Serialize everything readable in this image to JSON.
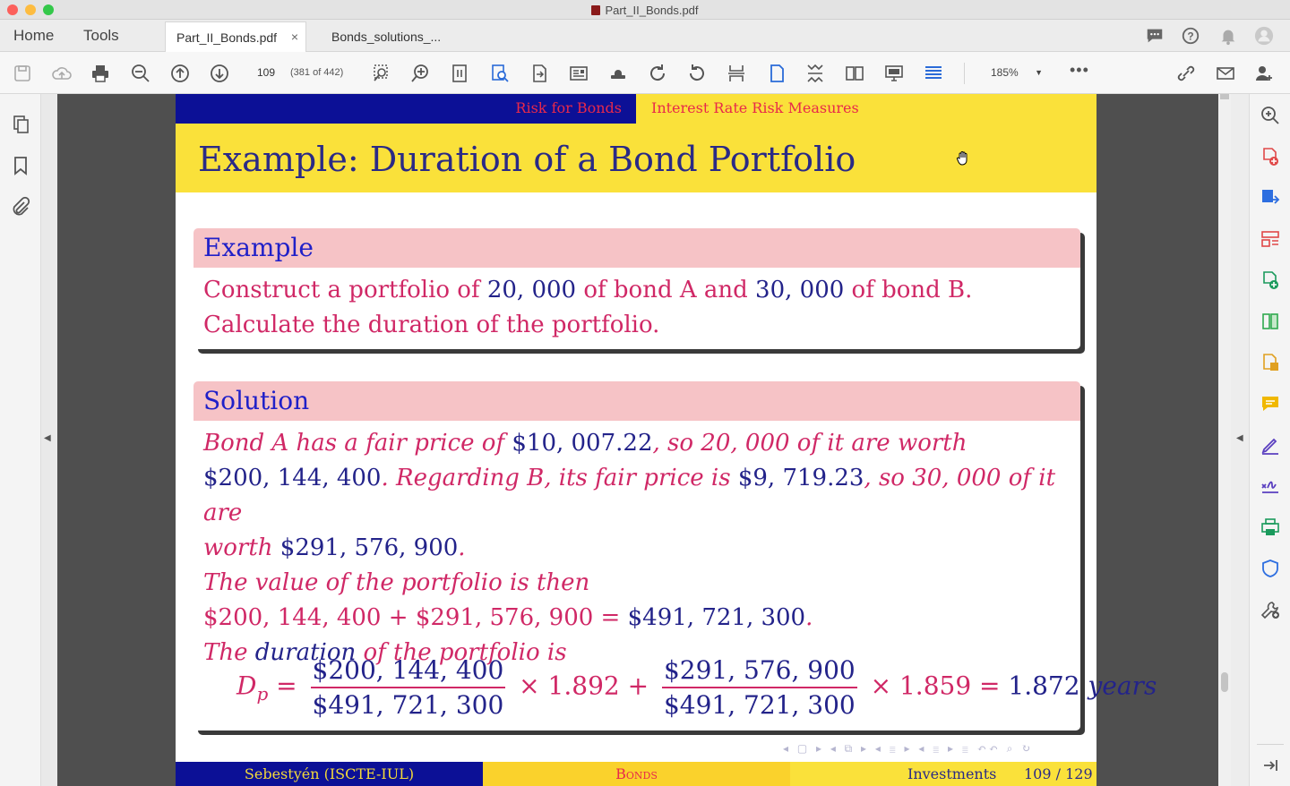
{
  "window": {
    "title": "Part_II_Bonds.pdf"
  },
  "tabs": {
    "home": "Home",
    "tools": "Tools",
    "documents": [
      {
        "label": "Part_II_Bonds.pdf",
        "active": true,
        "close": "×"
      },
      {
        "label": "Bonds_solutions_...",
        "active": false
      }
    ]
  },
  "toolbar": {
    "page_number": "109",
    "page_count": "(381 of 442)",
    "zoom": "185%",
    "more": "•••"
  },
  "slide": {
    "section": "Risk for Bonds",
    "subsection": "Interest Rate Risk Measures",
    "title": "Example: Duration of a Bond Portfolio",
    "example": {
      "heading": "Example",
      "line1_a": "Construct a portfolio of ",
      "line1_n1": "20, 000",
      "line1_b": " of bond A and ",
      "line1_n2": "30, 000",
      "line1_c": " of bond B.",
      "line2": "Calculate the duration of the portfolio."
    },
    "solution": {
      "heading": "Solution",
      "l1_a": "Bond A has a fair price of ",
      "l1_n1": "$10, 007.22",
      "l1_b": ", so ",
      "l1_n2": "20, 000",
      "l1_c": " of it are worth",
      "l2_n1": "$200, 144, 400",
      "l2_a": ". Regarding B, its fair price is ",
      "l2_n2": "$9, 719.23",
      "l2_b": ", so ",
      "l2_n3": "30, 000",
      "l2_c": " of it are",
      "l3_a": "worth ",
      "l3_n1": "$291, 576, 900",
      "l3_b": ".",
      "l4": "The value of the portfolio is then",
      "l5_n1": "$200, 144, 400",
      "l5_op": " + ",
      "l5_n2": "$291, 576, 900",
      "l5_eq": " = ",
      "l5_n3": "$491, 721, 300",
      "l5_dot": ".",
      "l6_a": "The ",
      "l6_n": "duration",
      "l6_b": " of the portfolio is",
      "formula": {
        "lhs": "D",
        "lhs_sub": "p",
        "eq": " = ",
        "num1": "$200, 144, 400",
        "den1": "$491, 721, 300",
        "times1": " × 1.892 + ",
        "num2": "$291, 576, 900",
        "den2": "$491, 721, 300",
        "times2": " × 1.859 = ",
        "result": "1.872",
        "unit": " years"
      }
    },
    "footer": {
      "author": "Sebestyén  (ISCTE-IUL)",
      "short_title": "Bonds",
      "course": "Investments",
      "page": "109 / 129"
    }
  },
  "colors": {
    "beamer_blue": "#0c1096",
    "beamer_yellow": "#fae13a",
    "block_head": "#f6c3c6",
    "text_red": "#d02866"
  }
}
